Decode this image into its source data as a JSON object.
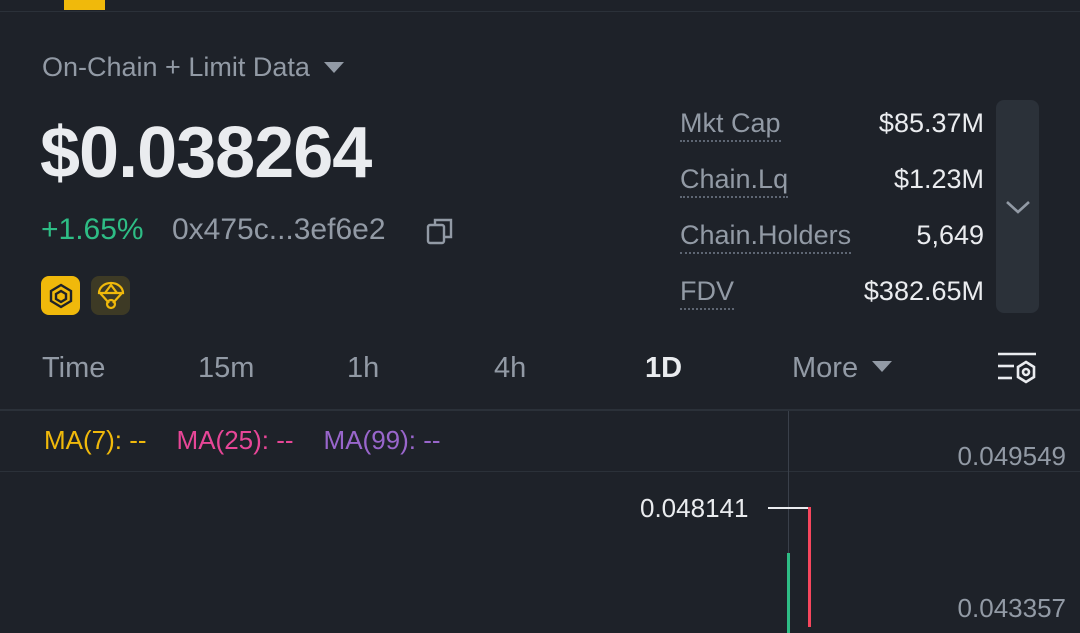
{
  "header": {
    "data_source": "On-Chain + Limit Data"
  },
  "token": {
    "price": "$0.038264",
    "change": "+1.65%",
    "address": "0x475c...3ef6e2"
  },
  "stats": [
    {
      "label": "Mkt Cap",
      "value": "$85.37M"
    },
    {
      "label": "Chain.Lq",
      "value": "$1.23M"
    },
    {
      "label": "Chain.Holders",
      "value": "5,649"
    },
    {
      "label": "FDV",
      "value": "$382.65M"
    }
  ],
  "intervals": {
    "time": "Time",
    "m15": "15m",
    "h1": "1h",
    "h4": "4h",
    "d1": "1D",
    "more": "More",
    "active": "1D"
  },
  "chart": {
    "ma7": "MA(7): --",
    "ma25": "MA(25): --",
    "ma99": "MA(99): --",
    "axis_top": "0.049549",
    "axis_bottom": "0.043357",
    "high_marker": "0.048141"
  },
  "colors": {
    "background": "#1e2229",
    "accent": "#f0b90b",
    "up": "#2ebd85",
    "down": "#f6465d",
    "ma7": "#f0b90b",
    "ma25": "#e84697",
    "ma99": "#9966cc"
  },
  "icons": {
    "copy": "copy-icon",
    "chain_badge": "bnb-chain-icon",
    "parachute_badge": "airdrop-parachute-icon",
    "expand": "chevron-down-icon",
    "chart_settings": "chart-settings-icon"
  }
}
